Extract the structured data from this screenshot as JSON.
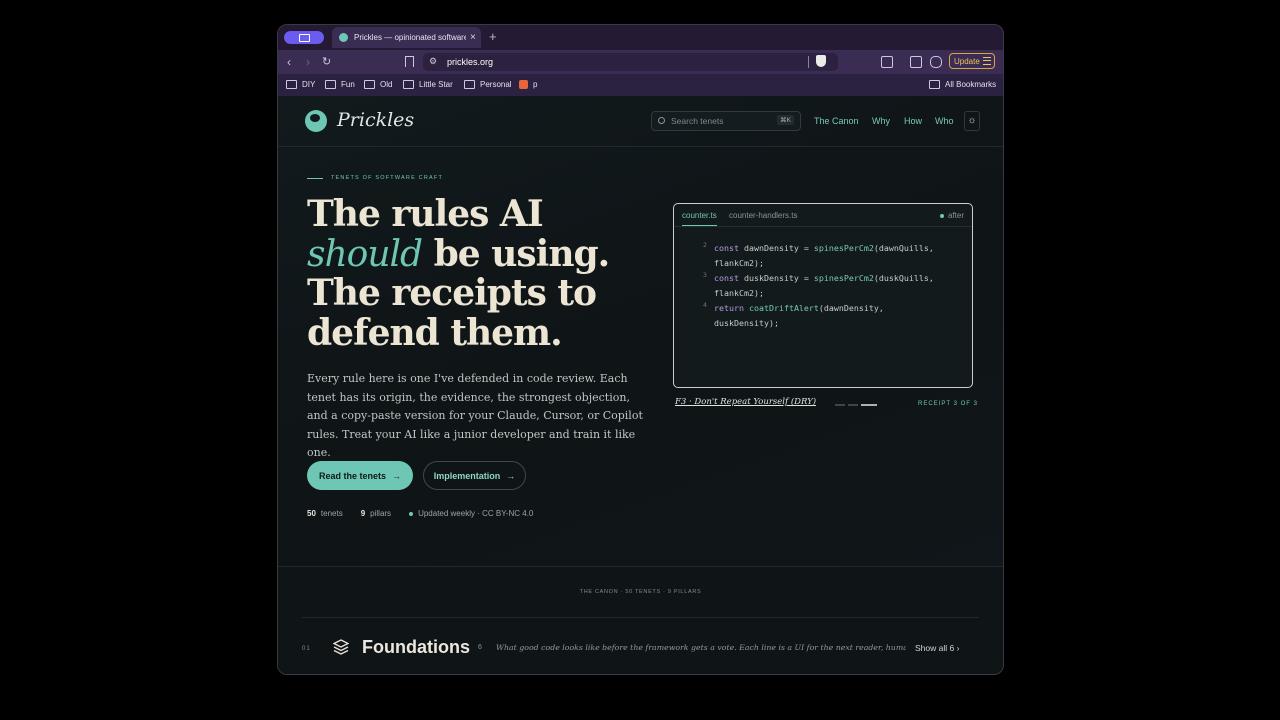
{
  "browser": {
    "tab_title": "Prickles — opinionated software",
    "url": "prickles.org",
    "update_label": "Update",
    "bookmarks": [
      "DIY",
      "Fun",
      "Old",
      "Little Star",
      "Personal",
      "p"
    ],
    "all_bookmarks": "All Bookmarks"
  },
  "site": {
    "logo": "Prickles",
    "search_placeholder": "Search tenets",
    "search_shortcut": "⌘K",
    "nav": [
      "The Canon",
      "Why",
      "How",
      "Who"
    ]
  },
  "hero": {
    "eyebrow": "TENETS OF SOFTWARE CRAFT",
    "title_1": "The rules AI",
    "title_2_em": "should",
    "title_2_rest": " be using.",
    "title_3": "The receipts to",
    "title_4": "defend them.",
    "description": "Every rule here is one I've defended in code review. Each tenet has its origin, the evidence, the strongest objection, and a copy-paste version for your Claude, Cursor, or Copilot rules. Treat your AI like a junior developer and train it like one.",
    "primary_button": "Read the tenets",
    "secondary_button": "Implementation",
    "stats": {
      "tenets_count": "50",
      "tenets_label": "tenets",
      "pillars_count": "9",
      "pillars_label": "pillars",
      "updated": "Updated weekly · CC BY-NC 4.0"
    }
  },
  "code_card": {
    "tabs": [
      "counter.ts",
      "counter-handlers.ts"
    ],
    "state": "after",
    "lines": [
      {
        "num": "2",
        "kw": "const",
        "text": " dawnDensity = ",
        "fn": "spinesPerCm2",
        "rest": "(dawnQuills,",
        "cont": "flankCm2);"
      },
      {
        "num": "3",
        "kw": "const",
        "text": " duskDensity = ",
        "fn": "spinesPerCm2",
        "rest": "(duskQuills,",
        "cont": "flankCm2);"
      },
      {
        "num": "4",
        "kw": "return",
        "text": " ",
        "fn": "coatDriftAlert",
        "rest": "(dawnDensity,",
        "cont": "duskDensity);"
      }
    ],
    "receipt_title": "F3 · Don't Repeat Yourself (DRY)",
    "receipt_count": "RECEIPT 3 OF 3",
    "receipt_index": 3,
    "receipt_total": 3
  },
  "canon": {
    "label": "THE CANON · 50 TENETS · 9 PILLARS",
    "pillar": {
      "num": "01",
      "title": "Foundations",
      "count": "6",
      "description": "What good code looks like before the framework gets a vote. Each line is a UI for the next reader, human …",
      "show_all": "Show all 6"
    }
  },
  "colors": {
    "accent": "#6ec7b4",
    "background": "#0f1416",
    "heading": "#ece5d3",
    "browser_chrome": "#3a2c52",
    "update": "#f1c15a"
  }
}
